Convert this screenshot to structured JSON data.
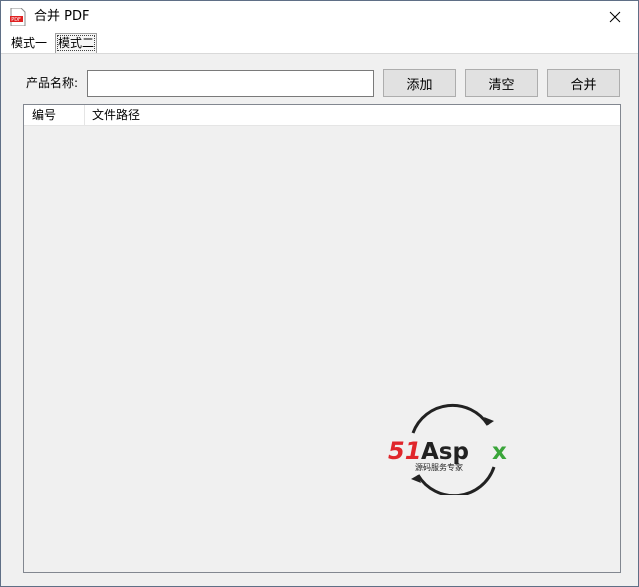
{
  "window": {
    "title": "合并 PDF",
    "icon_text": "PDF"
  },
  "tabs": [
    {
      "label": "模式一"
    },
    {
      "label": "模式二"
    }
  ],
  "form": {
    "product_label": "产品名称:",
    "product_value": ""
  },
  "buttons": {
    "add": "添加",
    "clear": "清空",
    "merge": "合并"
  },
  "list": {
    "columns": [
      "编号",
      "文件路径"
    ],
    "rows": []
  },
  "watermark": {
    "brand": "51Aspx",
    "slogan": "源码服务专家"
  },
  "colors": {
    "watermark_red": "#e0262b",
    "watermark_green": "#3aa53a",
    "panel_bg": "#f0f0f0"
  }
}
